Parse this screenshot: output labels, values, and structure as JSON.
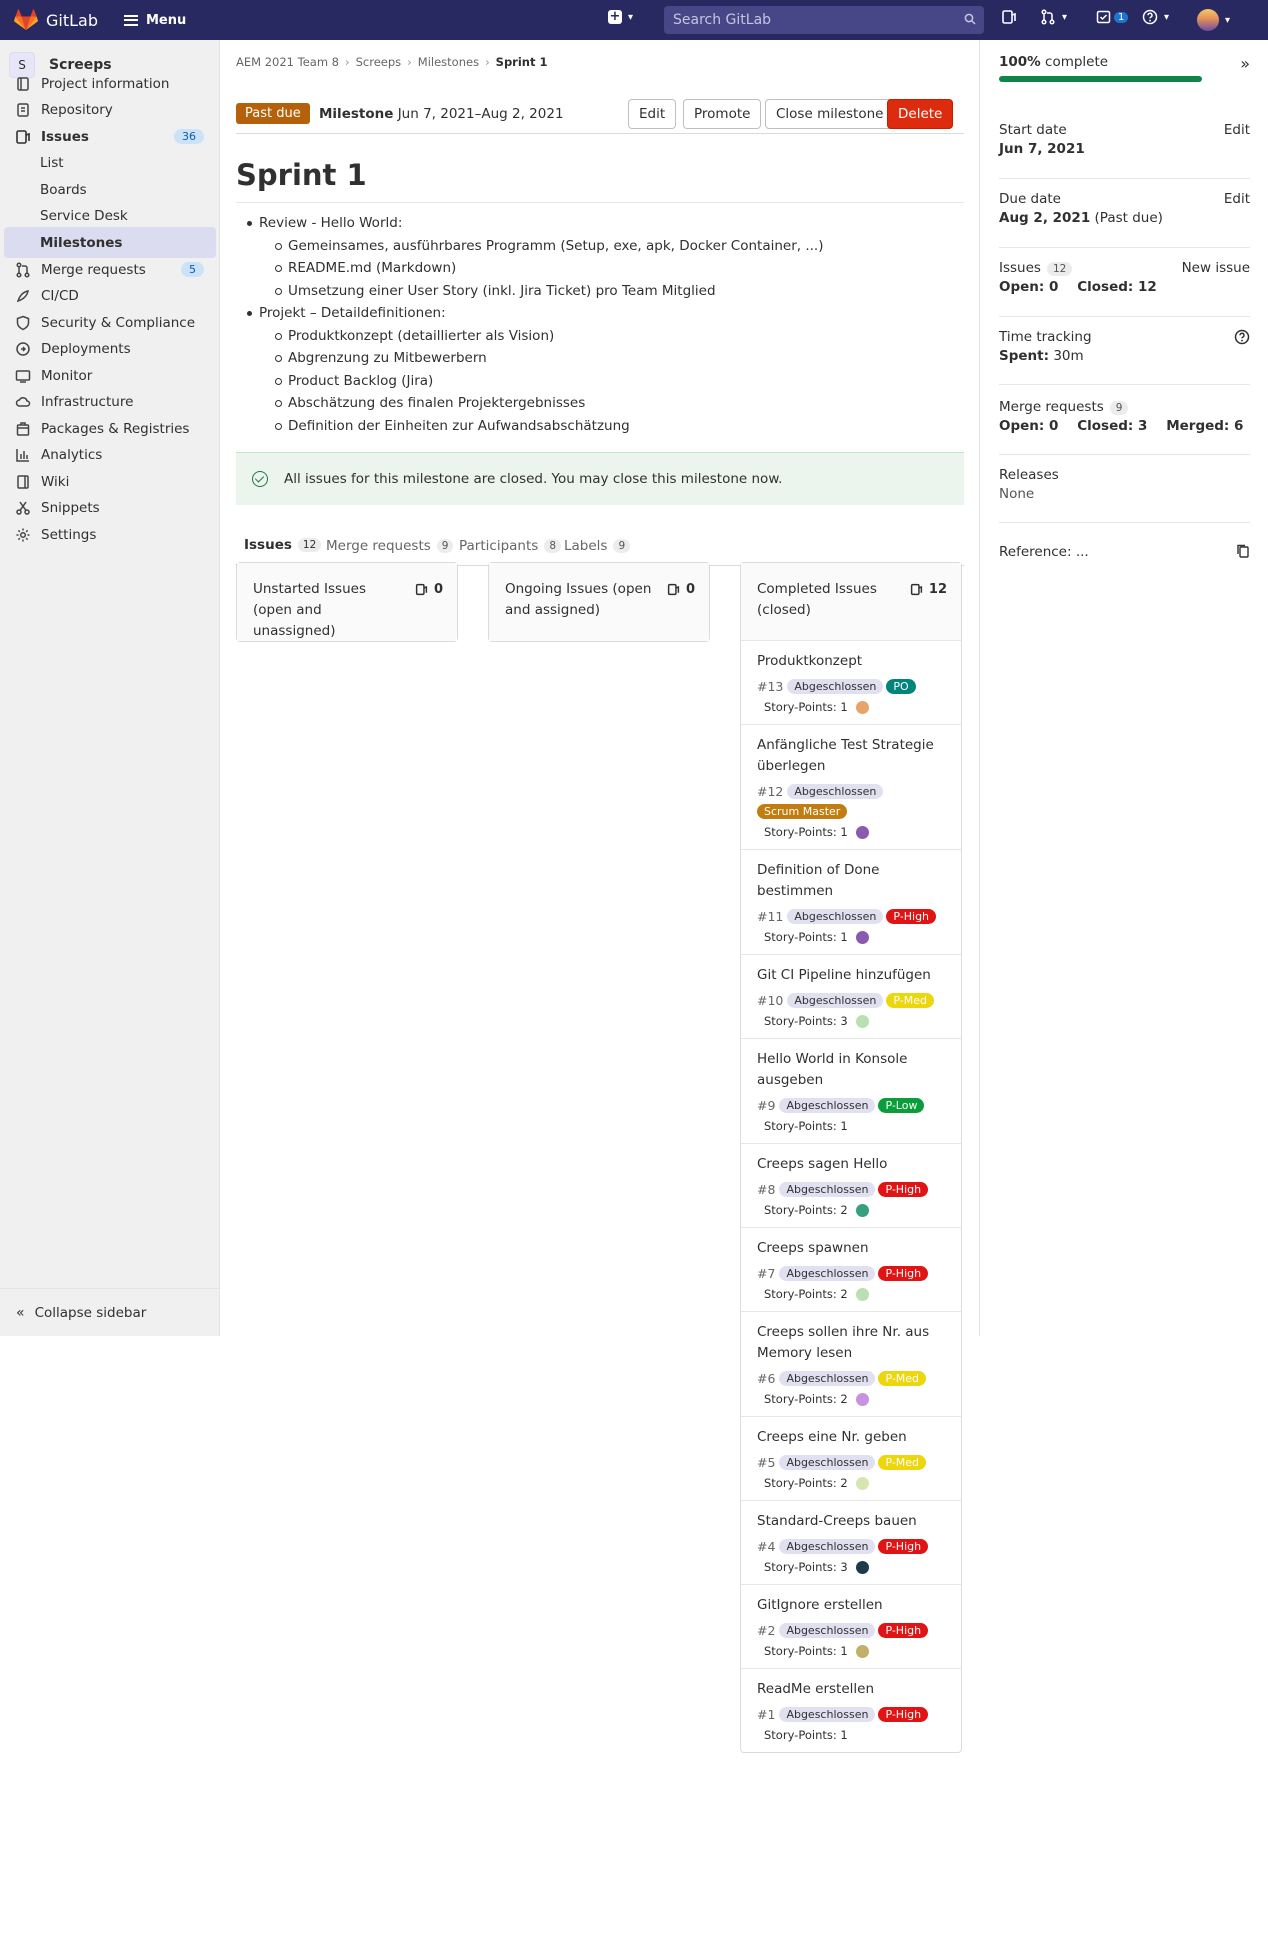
{
  "topbar": {
    "brand": "GitLab",
    "menu_label": "Menu",
    "search_placeholder": "Search GitLab",
    "todo_count": "1"
  },
  "sidebar": {
    "project_initial": "S",
    "project_name": "Screeps",
    "items": [
      {
        "label": "Project information",
        "icon": "project-info-icon"
      },
      {
        "label": "Repository",
        "icon": "repository-icon"
      },
      {
        "label": "Issues",
        "icon": "issues-icon",
        "badge": "36"
      },
      {
        "label": "List"
      },
      {
        "label": "Boards"
      },
      {
        "label": "Service Desk"
      },
      {
        "label": "Milestones"
      },
      {
        "label": "Merge requests",
        "icon": "merge-request-icon",
        "badge": "5"
      },
      {
        "label": "CI/CD",
        "icon": "rocket-icon"
      },
      {
        "label": "Security & Compliance",
        "icon": "shield-icon"
      },
      {
        "label": "Deployments",
        "icon": "deployments-icon"
      },
      {
        "label": "Monitor",
        "icon": "monitor-icon"
      },
      {
        "label": "Infrastructure",
        "icon": "cloud-icon"
      },
      {
        "label": "Packages & Registries",
        "icon": "package-icon"
      },
      {
        "label": "Analytics",
        "icon": "chart-icon"
      },
      {
        "label": "Wiki",
        "icon": "book-icon"
      },
      {
        "label": "Snippets",
        "icon": "scissors-icon"
      },
      {
        "label": "Settings",
        "icon": "gear-icon"
      }
    ],
    "collapse_label": "Collapse sidebar"
  },
  "breadcrumb": [
    "AEM 2021 Team 8",
    "Screeps",
    "Milestones",
    "Sprint 1"
  ],
  "milestone": {
    "status": "Past due",
    "label": "Milestone",
    "dates": "Jun 7, 2021–Aug 2, 2021",
    "buttons": {
      "edit": "Edit",
      "promote": "Promote",
      "close": "Close milestone",
      "delete": "Delete"
    },
    "title": "Sprint 1",
    "description": [
      {
        "level": 1,
        "text": "Review - Hello World:"
      },
      {
        "level": 2,
        "text": "Gemeinsames, ausführbares Programm (Setup, exe, apk, Docker Container, ...)"
      },
      {
        "level": 2,
        "text": "README.md (Markdown)"
      },
      {
        "level": 2,
        "text": "Umsetzung einer User Story (inkl. Jira Ticket) pro Team Mitglied"
      },
      {
        "level": 1,
        "text": "Projekt – Detaildefinitionen:"
      },
      {
        "level": 2,
        "text": "Produktkonzept (detaillierter als Vision)"
      },
      {
        "level": 2,
        "text": "Abgrenzung zu Mitbewerbern"
      },
      {
        "level": 2,
        "text": "Product Backlog (Jira)"
      },
      {
        "level": 2,
        "text": "Abschätzung des finalen Projektergebnisses"
      },
      {
        "level": 2,
        "text": "Definition der Einheiten zur Aufwandsabschätzung"
      }
    ],
    "alert": "All issues for this milestone are closed. You may close this milestone now."
  },
  "tabs": [
    {
      "label": "Issues",
      "count": "12"
    },
    {
      "label": "Merge requests",
      "count": "9"
    },
    {
      "label": "Participants",
      "count": "8"
    },
    {
      "label": "Labels",
      "count": "9"
    }
  ],
  "columns": {
    "unstarted": {
      "title": "Unstarted Issues (open and unassigned)",
      "count": "0"
    },
    "ongoing": {
      "title": "Ongoing Issues (open and assigned)",
      "count": "0"
    },
    "completed": {
      "title": "Completed Issues (closed)",
      "count": "12"
    }
  },
  "status_label": "Abgeschlossen",
  "issues": [
    {
      "title": "Produktkonzept",
      "number": "#13",
      "tag": "PO",
      "tag_color": "#00857a",
      "tag_text": "#ffffff",
      "points": "Story-Points: 1",
      "avatar": "#e8a36a"
    },
    {
      "title": "Anfängliche Test Strategie überlegen",
      "number": "#12",
      "tag": "Scrum Master",
      "tag_color": "#c17d10",
      "tag_text": "#ffffff",
      "points": "Story-Points: 1",
      "avatar": "#8a5ab0"
    },
    {
      "title": "Definition of Done bestimmen",
      "number": "#11",
      "tag": "P-High",
      "tag_color": "#e01414",
      "tag_text": "#ffffff",
      "points": "Story-Points: 1",
      "avatar": "#8a5ab0"
    },
    {
      "title": "Git CI Pipeline hinzufügen",
      "number": "#10",
      "tag": "P-Med",
      "tag_color": "#ecd60e",
      "tag_text": "#ffffff",
      "points": "Story-Points: 3",
      "avatar": "#b8e0b0"
    },
    {
      "title": "Hello World in Konsole ausgeben",
      "number": "#9",
      "tag": "P-Low",
      "tag_color": "#0a9e3a",
      "tag_text": "#ffffff",
      "points": "Story-Points: 1",
      "avatar": ""
    },
    {
      "title": "Creeps sagen Hello",
      "number": "#8",
      "tag": "P-High",
      "tag_color": "#e01414",
      "tag_text": "#ffffff",
      "points": "Story-Points: 2",
      "avatar": "#35a07a"
    },
    {
      "title": "Creeps spawnen",
      "number": "#7",
      "tag": "P-High",
      "tag_color": "#e01414",
      "tag_text": "#ffffff",
      "points": "Story-Points: 2",
      "avatar": "#b8e0b0"
    },
    {
      "title": "Creeps sollen ihre Nr. aus Memory lesen",
      "number": "#6",
      "tag": "P-Med",
      "tag_color": "#ecd60e",
      "tag_text": "#ffffff",
      "points": "Story-Points: 2",
      "avatar": "#c892e0"
    },
    {
      "title": "Creeps eine Nr. geben",
      "number": "#5",
      "tag": "P-Med",
      "tag_color": "#ecd60e",
      "tag_text": "#ffffff",
      "points": "Story-Points: 2",
      "avatar": "#d6e6b0"
    },
    {
      "title": "Standard-Creeps bauen",
      "number": "#4",
      "tag": "P-High",
      "tag_color": "#e01414",
      "tag_text": "#ffffff",
      "points": "Story-Points: 3",
      "avatar": "#1e3a46"
    },
    {
      "title": "GitIgnore erstellen",
      "number": "#2",
      "tag": "P-High",
      "tag_color": "#e01414",
      "tag_text": "#ffffff",
      "points": "Story-Points: 1",
      "avatar": "#c2b06a"
    },
    {
      "title": "ReadMe erstellen",
      "number": "#1",
      "tag": "P-High",
      "tag_color": "#e01414",
      "tag_text": "#ffffff",
      "points": "Story-Points: 1",
      "avatar": ""
    }
  ],
  "right_sidebar": {
    "progress_percent": 100,
    "progress_text_bold": "100%",
    "progress_text": "complete",
    "start_label": "Start date",
    "start_value": "Jun 7, 2021",
    "due_label": "Due date",
    "due_value": "Aug 2, 2021",
    "due_note": "(Past due)",
    "edit": "Edit",
    "issues_label": "Issues",
    "issues_count": "12",
    "new_issue": "New issue",
    "issues_open": "Open: 0",
    "issues_closed": "Closed: 12",
    "time_label": "Time tracking",
    "time_spent_label": "Spent:",
    "time_spent_value": "30m",
    "mr_label": "Merge requests",
    "mr_count": "9",
    "mr_open": "Open: 0",
    "mr_closed": "Closed: 3",
    "mr_merged": "Merged: 6",
    "releases_label": "Releases",
    "releases_value": "None",
    "reference_label": "Reference: ..."
  }
}
